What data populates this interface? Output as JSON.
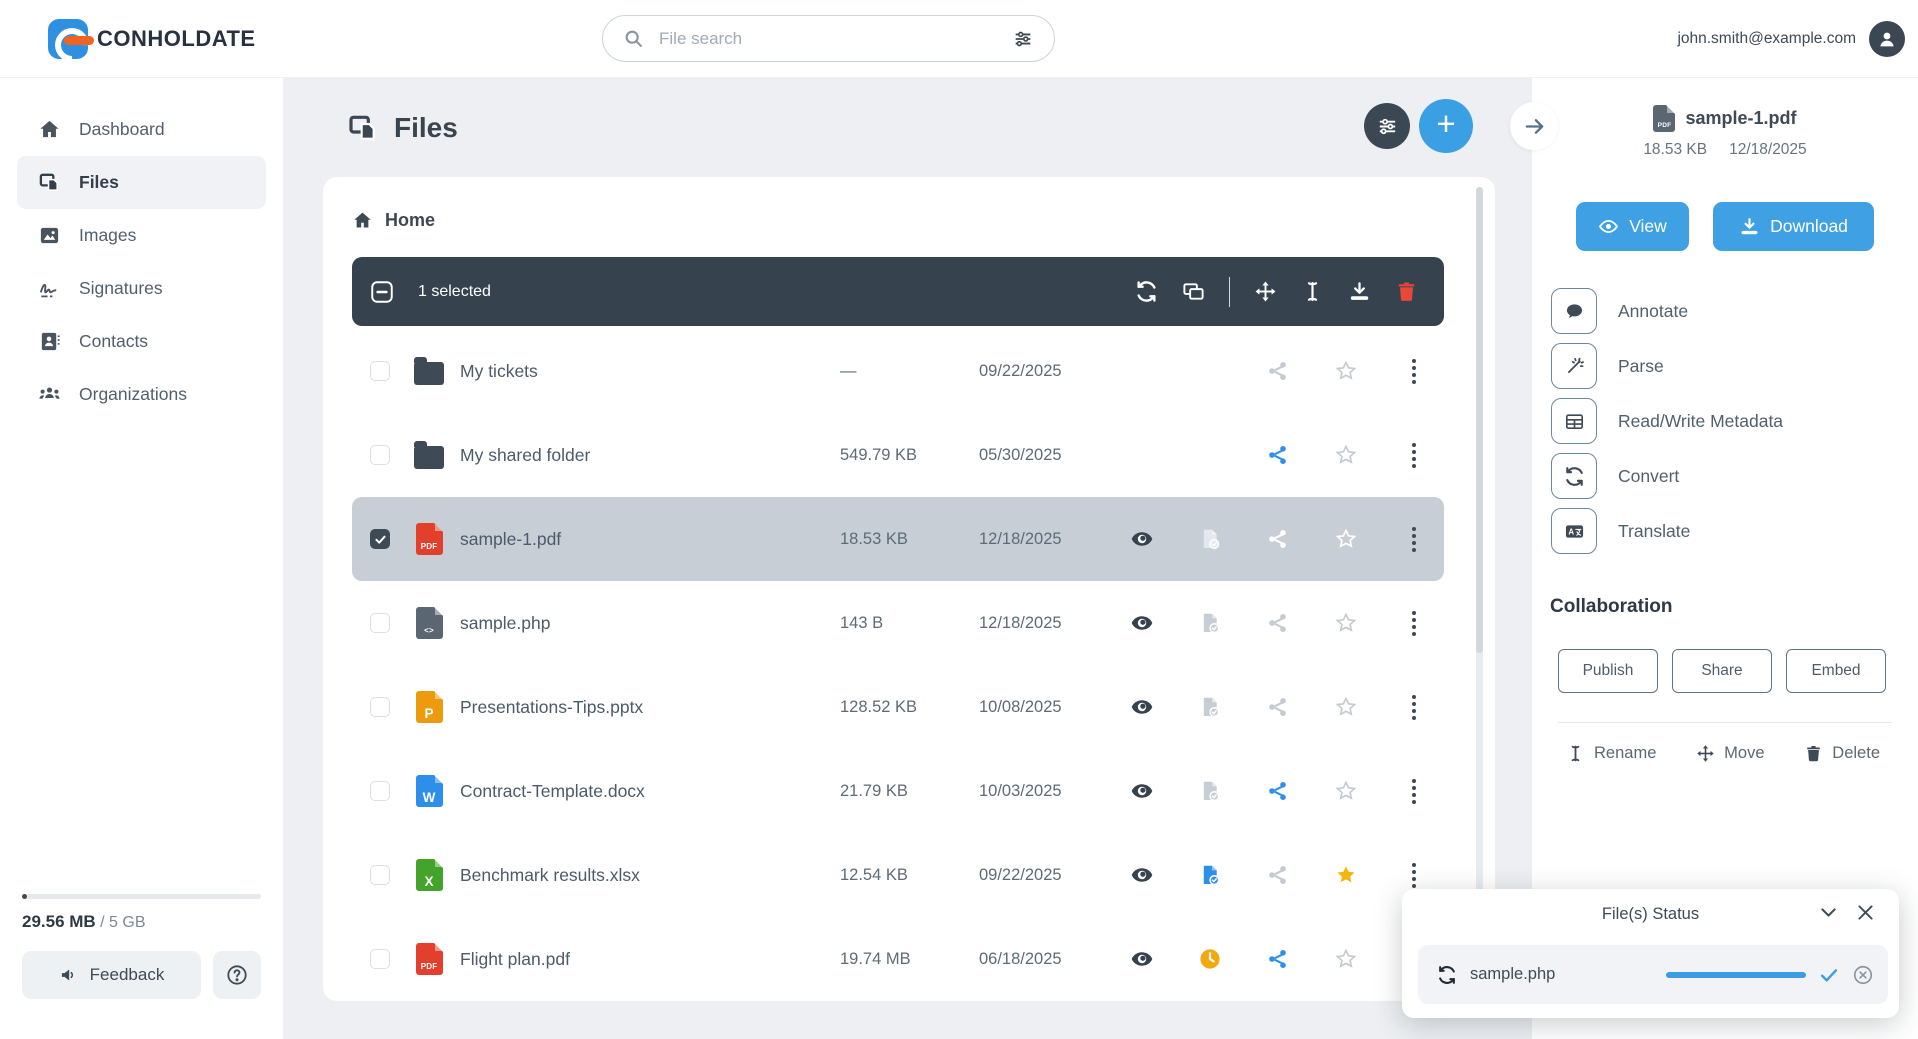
{
  "topbar": {
    "logo_text": "CONHOLDATE",
    "search_placeholder": "File search",
    "user_email": "john.smith@example.com"
  },
  "sidebar": {
    "items": [
      {
        "label": "Dashboard",
        "icon": "home",
        "active": false
      },
      {
        "label": "Files",
        "icon": "files",
        "active": true
      },
      {
        "label": "Images",
        "icon": "image",
        "active": false
      },
      {
        "label": "Signatures",
        "icon": "signature",
        "active": false
      },
      {
        "label": "Contacts",
        "icon": "contacts",
        "active": false
      },
      {
        "label": "Organizations",
        "icon": "organizations",
        "active": false
      }
    ],
    "storage_used": "29.56 MB",
    "storage_total": " / 5 GB",
    "feedback_label": "Feedback"
  },
  "main": {
    "title": "Files",
    "breadcrumb": "Home",
    "toolbar": {
      "selected_text": "1 selected"
    },
    "files": [
      {
        "name": "My tickets",
        "type": "folder",
        "badge": "",
        "size": "—",
        "date": "09/22/2025",
        "selected": false,
        "eye": false,
        "doc": "none",
        "share": "gray",
        "star": "outline"
      },
      {
        "name": "My shared folder",
        "type": "folder",
        "badge": "",
        "size": "549.79 KB",
        "date": "05/30/2025",
        "selected": false,
        "eye": false,
        "doc": "none",
        "share": "blue",
        "star": "outline"
      },
      {
        "name": "sample-1.pdf",
        "type": "pdf",
        "badge": "PDF",
        "size": "18.53 KB",
        "date": "12/18/2025",
        "selected": true,
        "eye": true,
        "doc": "light",
        "share": "white",
        "star": "outline-white"
      },
      {
        "name": "sample.php",
        "type": "php",
        "badge": "<>",
        "size": "143 B",
        "date": "12/18/2025",
        "selected": false,
        "eye": true,
        "doc": "gray",
        "share": "gray",
        "star": "outline"
      },
      {
        "name": "Presentations-Tips.pptx",
        "type": "pptx",
        "badge": "P",
        "size": "128.52 KB",
        "date": "10/08/2025",
        "selected": false,
        "eye": true,
        "doc": "gray",
        "share": "gray",
        "star": "outline"
      },
      {
        "name": "Contract-Template.docx",
        "type": "docx",
        "badge": "W",
        "size": "21.79 KB",
        "date": "10/03/2025",
        "selected": false,
        "eye": true,
        "doc": "gray",
        "share": "blue",
        "star": "outline"
      },
      {
        "name": "Benchmark results.xlsx",
        "type": "xlsx",
        "badge": "X",
        "size": "12.54 KB",
        "date": "09/22/2025",
        "selected": false,
        "eye": true,
        "doc": "blue",
        "share": "gray",
        "star": "filled"
      },
      {
        "name": "Flight plan.pdf",
        "type": "pdf",
        "badge": "PDF",
        "size": "19.74 MB",
        "date": "06/18/2025",
        "selected": false,
        "eye": true,
        "doc": "clock",
        "share": "blue",
        "star": "outline"
      }
    ]
  },
  "panel": {
    "file_name": "sample-1.pdf",
    "file_badge": "PDF",
    "file_size": "18.53 KB",
    "file_date": "12/18/2025",
    "view_label": "View",
    "download_label": "Download",
    "actions": [
      {
        "label": "Annotate",
        "icon": "bubble"
      },
      {
        "label": "Parse",
        "icon": "wand"
      },
      {
        "label": "Read/Write Metadata",
        "icon": "table"
      },
      {
        "label": "Convert",
        "icon": "refresh"
      },
      {
        "label": "Translate",
        "icon": "translate"
      }
    ],
    "collaboration_title": "Collaboration",
    "collaboration_buttons": [
      "Publish",
      "Share",
      "Embed"
    ],
    "file_operations": [
      {
        "label": "Rename",
        "icon": "ibeam"
      },
      {
        "label": "Move",
        "icon": "move"
      },
      {
        "label": "Delete",
        "icon": "trash"
      }
    ]
  },
  "status_popup": {
    "title": "File(s) Status",
    "file_name": "sample.php",
    "progress_percent": 100
  },
  "colors": {
    "accent_blue": "#3fa0e4",
    "star_yellow": "#f6b50b",
    "danger_red": "#e2402c",
    "dark_slate": "#36424e"
  }
}
